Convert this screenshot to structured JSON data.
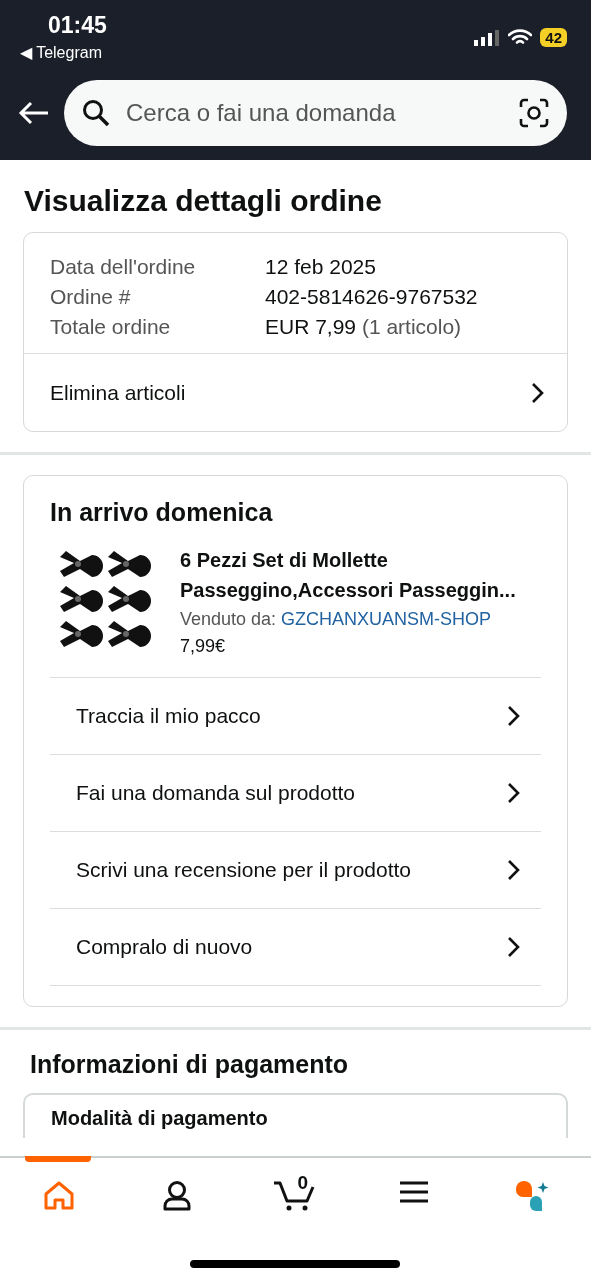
{
  "status_bar": {
    "time": "01:45",
    "back_app": "◀ Telegram",
    "battery": "42"
  },
  "search": {
    "placeholder": "Cerca o fai una domanda"
  },
  "title": "Visualizza dettagli ordine",
  "order": {
    "rows": [
      {
        "label": "Data dell'ordine",
        "value": "12 feb 2025"
      },
      {
        "label": "Ordine #",
        "value": "402-5814626-9767532"
      },
      {
        "label": "Totale ordine",
        "value": "EUR 7,99",
        "note": "(1 articolo)"
      }
    ],
    "action": "Elimina articoli"
  },
  "shipment": {
    "heading": "In arrivo domenica",
    "product": {
      "title": "6 Pezzi Set di Mollette Passeggino,Accessori Passeggin...",
      "seller_label": "Venduto da:",
      "seller": "GZCHANXUANSM-SHOP",
      "price": "7,99€"
    },
    "actions": [
      "Traccia il mio pacco",
      "Fai una domanda sul prodotto",
      "Scrivi una recensione per il prodotto",
      "Compralo di nuovo"
    ]
  },
  "payment": {
    "heading": "Informazioni di pagamento",
    "card_title": "Modalità di pagamento"
  },
  "tab_bar": [
    {
      "kind": "home",
      "selected": true
    },
    {
      "kind": "account",
      "selected": false
    },
    {
      "kind": "cart",
      "selected": false,
      "count": "0"
    },
    {
      "kind": "menu",
      "selected": false
    },
    {
      "kind": "assistant",
      "selected": false
    }
  ]
}
